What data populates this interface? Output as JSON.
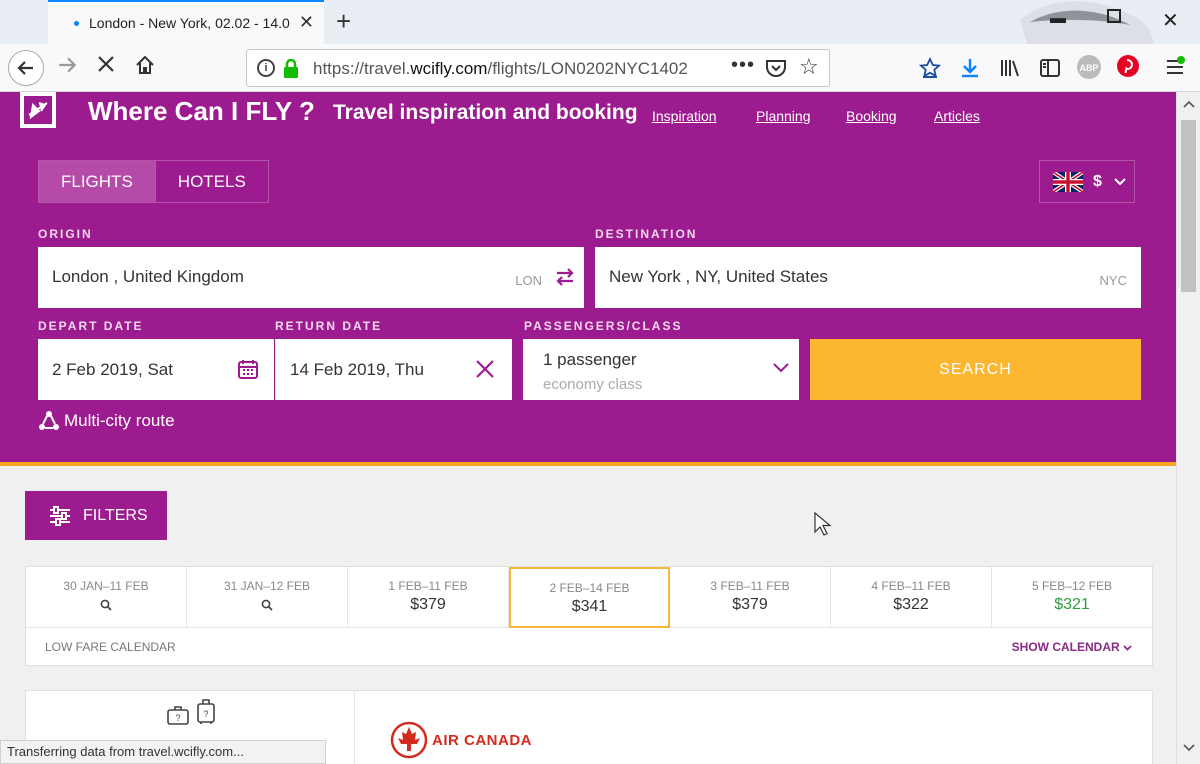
{
  "browser": {
    "tab_title": "London - New York, 02.02 - 14.0",
    "url_prefix": "https://travel.",
    "url_domain": "wcifly.com",
    "url_path": "/flights/LON0202NYC1402",
    "adblock_label": "ABP",
    "status_text": "Transferring data from travel.wcifly.com..."
  },
  "header": {
    "brand": "Where Can I FLY ?",
    "tagline": "Travel inspiration and booking",
    "links": [
      "Inspiration",
      "Planning",
      "Booking",
      "Articles"
    ]
  },
  "search": {
    "mode_tabs": [
      "FLIGHTS",
      "HOTELS"
    ],
    "active_mode": "FLIGHTS",
    "currency": "$",
    "origin_label": "ORIGIN",
    "origin_value": "London , United Kingdom",
    "origin_code": "LON",
    "destination_label": "DESTINATION",
    "destination_value": "New York , NY, United States",
    "destination_code": "NYC",
    "depart_label": "DEPART DATE",
    "depart_value": "2 Feb 2019, Sat",
    "return_label": "RETURN DATE",
    "return_value": "14 Feb 2019, Thu",
    "pax_label": "PASSENGERS/CLASS",
    "pax_value": "1 passenger",
    "class_value": "economy class",
    "search_button": "SEARCH",
    "multi_city": "Multi-city route"
  },
  "results": {
    "filters_button": "FILTERS",
    "fare_calendar": [
      {
        "dates": "30 JAN–11 FEB",
        "price": null
      },
      {
        "dates": "31 JAN–12 FEB",
        "price": null
      },
      {
        "dates": "1 FEB–11 FEB",
        "price": "$379"
      },
      {
        "dates": "2 FEB–14 FEB",
        "price": "$341",
        "selected": true
      },
      {
        "dates": "3 FEB–11 FEB",
        "price": "$379"
      },
      {
        "dates": "4 FEB–11 FEB",
        "price": "$322"
      },
      {
        "dates": "5 FEB–12 FEB",
        "price": "$321",
        "best": true
      }
    ],
    "low_fare_label": "LOW FARE CALENDAR",
    "show_calendar_label": "SHOW CALENDAR",
    "airline_name": "AIR CANADA"
  },
  "colors": {
    "brand_purple": "#9c1c8f",
    "accent_orange": "#fcb630",
    "best_price_green": "#2e9e3e",
    "airline_red": "#d52b1e"
  }
}
